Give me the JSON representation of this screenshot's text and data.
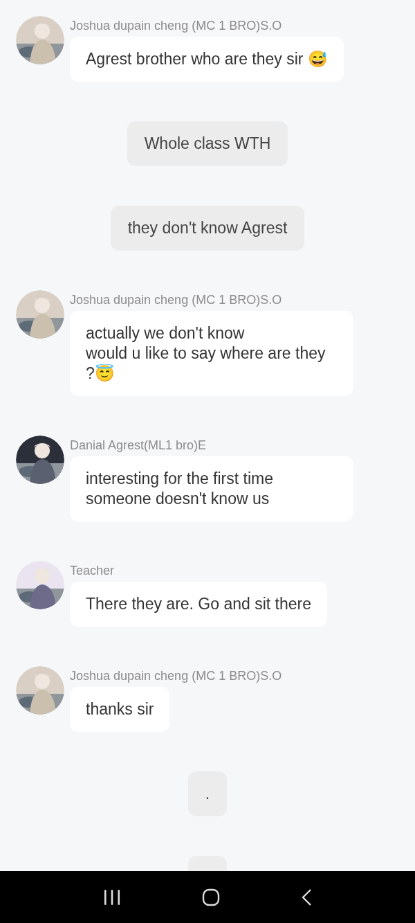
{
  "messages": [
    {
      "kind": "incoming",
      "sender": "Joshua dupain cheng (MC 1 BRO)S.O",
      "text": "Agrest brother who are they sir 😅"
    },
    {
      "kind": "narration",
      "text": "Whole class WTH"
    },
    {
      "kind": "narration",
      "text": "they don't know Agrest"
    },
    {
      "kind": "incoming",
      "sender": "Joshua dupain cheng (MC 1 BRO)S.O",
      "text": "actually we don't know\nwould u like to say where are they ?😇"
    },
    {
      "kind": "incoming",
      "sender": "Danial Agrest(ML1 bro)E",
      "text": "interesting for the first time someone doesn't know us"
    },
    {
      "kind": "incoming",
      "sender": "Teacher",
      "text": "There they are.  Go and sit there"
    },
    {
      "kind": "incoming",
      "sender": "Joshua dupain cheng (MC 1 BRO)S.O",
      "text": "thanks sir"
    },
    {
      "kind": "narration",
      "text": "."
    },
    {
      "kind": "narration"
    }
  ]
}
